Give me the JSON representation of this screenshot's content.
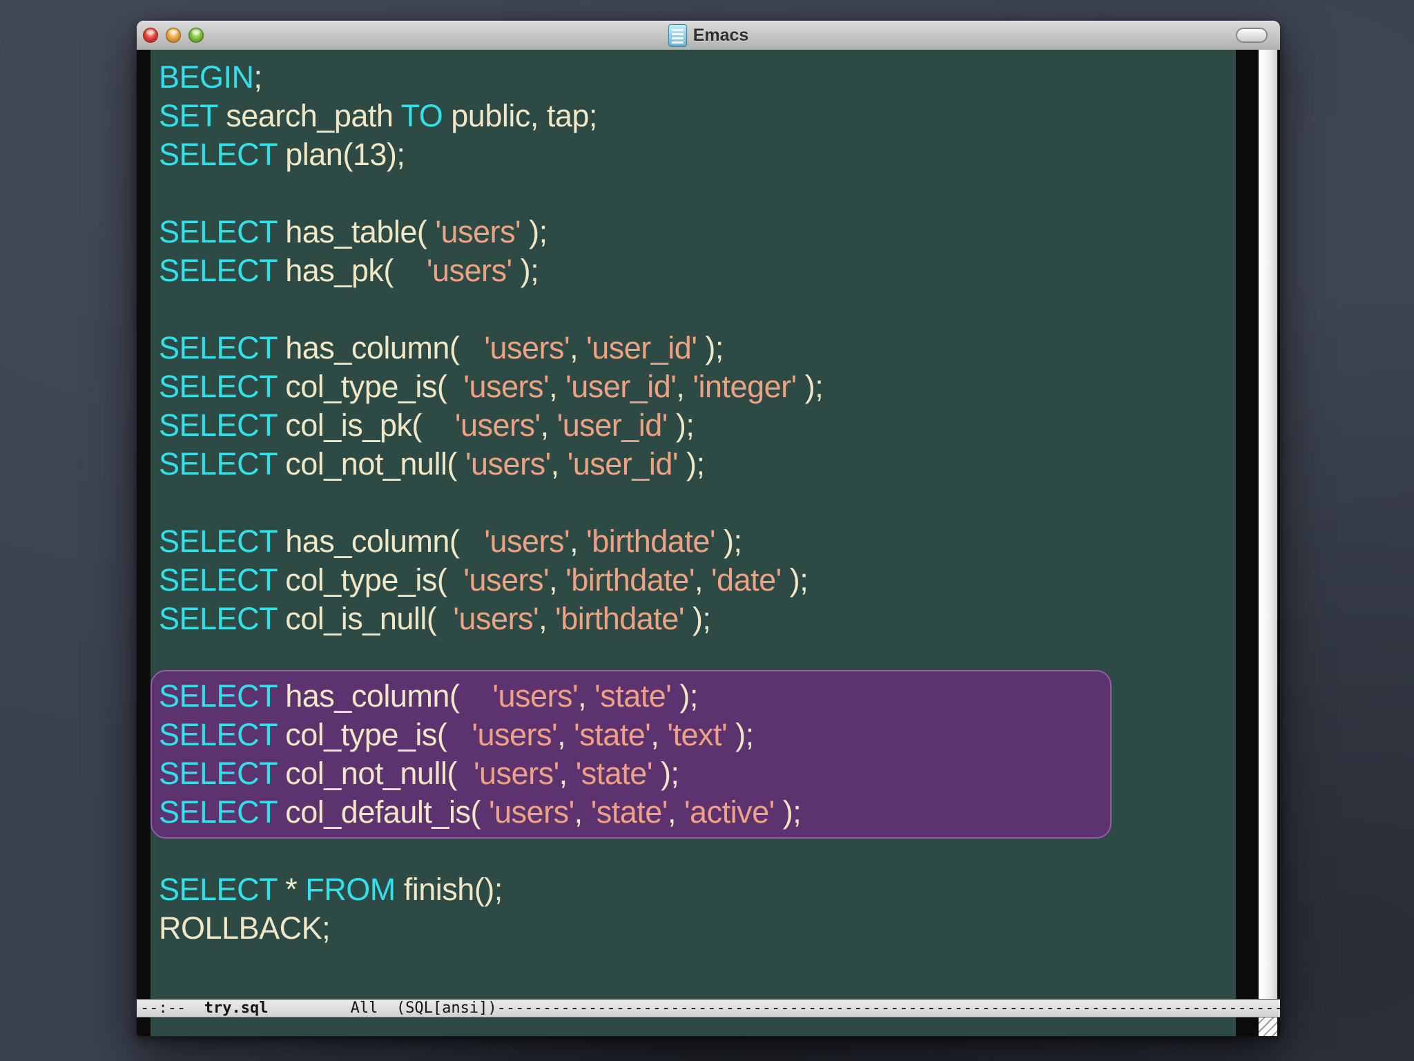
{
  "window": {
    "title": "Emacs"
  },
  "colors": {
    "keyword": "#30e1ec",
    "plain_text": "#efe7c6",
    "string": "#efa183",
    "editor_background": "#2e4a44",
    "selection_background": "#5d336f",
    "selection_border": "#9b59ab",
    "close_button": "#e2403a",
    "minimize_button": "#e8a43c",
    "zoom_button": "#7dc043"
  },
  "editor": {
    "lines": [
      {
        "spans": [
          {
            "t": "BEGIN",
            "c": "k"
          },
          {
            "t": ";",
            "c": "t"
          }
        ]
      },
      {
        "spans": [
          {
            "t": "SET",
            "c": "k"
          },
          {
            "t": " search_path ",
            "c": "t"
          },
          {
            "t": "TO",
            "c": "k"
          },
          {
            "t": " public, tap;",
            "c": "t"
          }
        ]
      },
      {
        "spans": [
          {
            "t": "SELECT",
            "c": "k"
          },
          {
            "t": " plan(13);",
            "c": "t"
          }
        ]
      },
      {
        "spans": []
      },
      {
        "spans": [
          {
            "t": "SELECT",
            "c": "k"
          },
          {
            "t": " has_table( ",
            "c": "t"
          },
          {
            "t": "'users'",
            "c": "s"
          },
          {
            "t": " );",
            "c": "t"
          }
        ]
      },
      {
        "spans": [
          {
            "t": "SELECT",
            "c": "k"
          },
          {
            "t": " has_pk(    ",
            "c": "t"
          },
          {
            "t": "'users'",
            "c": "s"
          },
          {
            "t": " );",
            "c": "t"
          }
        ]
      },
      {
        "spans": []
      },
      {
        "spans": [
          {
            "t": "SELECT",
            "c": "k"
          },
          {
            "t": " has_column(   ",
            "c": "t"
          },
          {
            "t": "'users'",
            "c": "s"
          },
          {
            "t": ", ",
            "c": "t"
          },
          {
            "t": "'user_id'",
            "c": "s"
          },
          {
            "t": " );",
            "c": "t"
          }
        ]
      },
      {
        "spans": [
          {
            "t": "SELECT",
            "c": "k"
          },
          {
            "t": " col_type_is(  ",
            "c": "t"
          },
          {
            "t": "'users'",
            "c": "s"
          },
          {
            "t": ", ",
            "c": "t"
          },
          {
            "t": "'user_id'",
            "c": "s"
          },
          {
            "t": ", ",
            "c": "t"
          },
          {
            "t": "'integer'",
            "c": "s"
          },
          {
            "t": " );",
            "c": "t"
          }
        ]
      },
      {
        "spans": [
          {
            "t": "SELECT",
            "c": "k"
          },
          {
            "t": " col_is_pk(    ",
            "c": "t"
          },
          {
            "t": "'users'",
            "c": "s"
          },
          {
            "t": ", ",
            "c": "t"
          },
          {
            "t": "'user_id'",
            "c": "s"
          },
          {
            "t": " );",
            "c": "t"
          }
        ]
      },
      {
        "spans": [
          {
            "t": "SELECT",
            "c": "k"
          },
          {
            "t": " col_not_null( ",
            "c": "t"
          },
          {
            "t": "'users'",
            "c": "s"
          },
          {
            "t": ", ",
            "c": "t"
          },
          {
            "t": "'user_id'",
            "c": "s"
          },
          {
            "t": " );",
            "c": "t"
          }
        ]
      },
      {
        "spans": []
      },
      {
        "spans": [
          {
            "t": "SELECT",
            "c": "k"
          },
          {
            "t": " has_column(   ",
            "c": "t"
          },
          {
            "t": "'users'",
            "c": "s"
          },
          {
            "t": ", ",
            "c": "t"
          },
          {
            "t": "'birthdate'",
            "c": "s"
          },
          {
            "t": " );",
            "c": "t"
          }
        ]
      },
      {
        "spans": [
          {
            "t": "SELECT",
            "c": "k"
          },
          {
            "t": " col_type_is(  ",
            "c": "t"
          },
          {
            "t": "'users'",
            "c": "s"
          },
          {
            "t": ", ",
            "c": "t"
          },
          {
            "t": "'birthdate'",
            "c": "s"
          },
          {
            "t": ", ",
            "c": "t"
          },
          {
            "t": "'date'",
            "c": "s"
          },
          {
            "t": " );",
            "c": "t"
          }
        ]
      },
      {
        "spans": [
          {
            "t": "SELECT",
            "c": "k"
          },
          {
            "t": " col_is_null(  ",
            "c": "t"
          },
          {
            "t": "'users'",
            "c": "s"
          },
          {
            "t": ", ",
            "c": "t"
          },
          {
            "t": "'birthdate'",
            "c": "s"
          },
          {
            "t": " );",
            "c": "t"
          }
        ]
      },
      {
        "spans": []
      },
      {
        "sel": true,
        "spans": [
          {
            "t": "SELECT",
            "c": "k"
          },
          {
            "t": " has_column(    ",
            "c": "t"
          },
          {
            "t": "'users'",
            "c": "s"
          },
          {
            "t": ", ",
            "c": "t"
          },
          {
            "t": "'state'",
            "c": "s"
          },
          {
            "t": " );",
            "c": "t"
          }
        ]
      },
      {
        "sel": true,
        "spans": [
          {
            "t": "SELECT",
            "c": "k"
          },
          {
            "t": " col_type_is(   ",
            "c": "t"
          },
          {
            "t": "'users'",
            "c": "s"
          },
          {
            "t": ", ",
            "c": "t"
          },
          {
            "t": "'state'",
            "c": "s"
          },
          {
            "t": ", ",
            "c": "t"
          },
          {
            "t": "'text'",
            "c": "s"
          },
          {
            "t": " );",
            "c": "t"
          }
        ]
      },
      {
        "sel": true,
        "spans": [
          {
            "t": "SELECT",
            "c": "k"
          },
          {
            "t": " col_not_null(  ",
            "c": "t"
          },
          {
            "t": "'users'",
            "c": "s"
          },
          {
            "t": ", ",
            "c": "t"
          },
          {
            "t": "'state'",
            "c": "s"
          },
          {
            "t": " );",
            "c": "t"
          }
        ]
      },
      {
        "sel": true,
        "spans": [
          {
            "t": "SELECT",
            "c": "k"
          },
          {
            "t": " col_default_is( ",
            "c": "t"
          },
          {
            "t": "'users'",
            "c": "s"
          },
          {
            "t": ", ",
            "c": "t"
          },
          {
            "t": "'state'",
            "c": "s"
          },
          {
            "t": ", ",
            "c": "t"
          },
          {
            "t": "'active'",
            "c": "s"
          },
          {
            "t": " );",
            "c": "t"
          }
        ]
      },
      {
        "spans": []
      },
      {
        "spans": [
          {
            "t": "SELECT",
            "c": "k"
          },
          {
            "t": " * ",
            "c": "t"
          },
          {
            "t": "FROM",
            "c": "k"
          },
          {
            "t": " finish();",
            "c": "t"
          }
        ]
      },
      {
        "spans": [
          {
            "t": "ROLLBACK;",
            "c": "t"
          }
        ]
      }
    ]
  },
  "modeline": {
    "prefix": "--:--  ",
    "buffer_name": "try.sql",
    "gap1": "         ",
    "position": "All",
    "gap2": "  ",
    "mode": "(SQL[ansi])",
    "dashes": "------------------------------------------------------------------------------------------"
  }
}
